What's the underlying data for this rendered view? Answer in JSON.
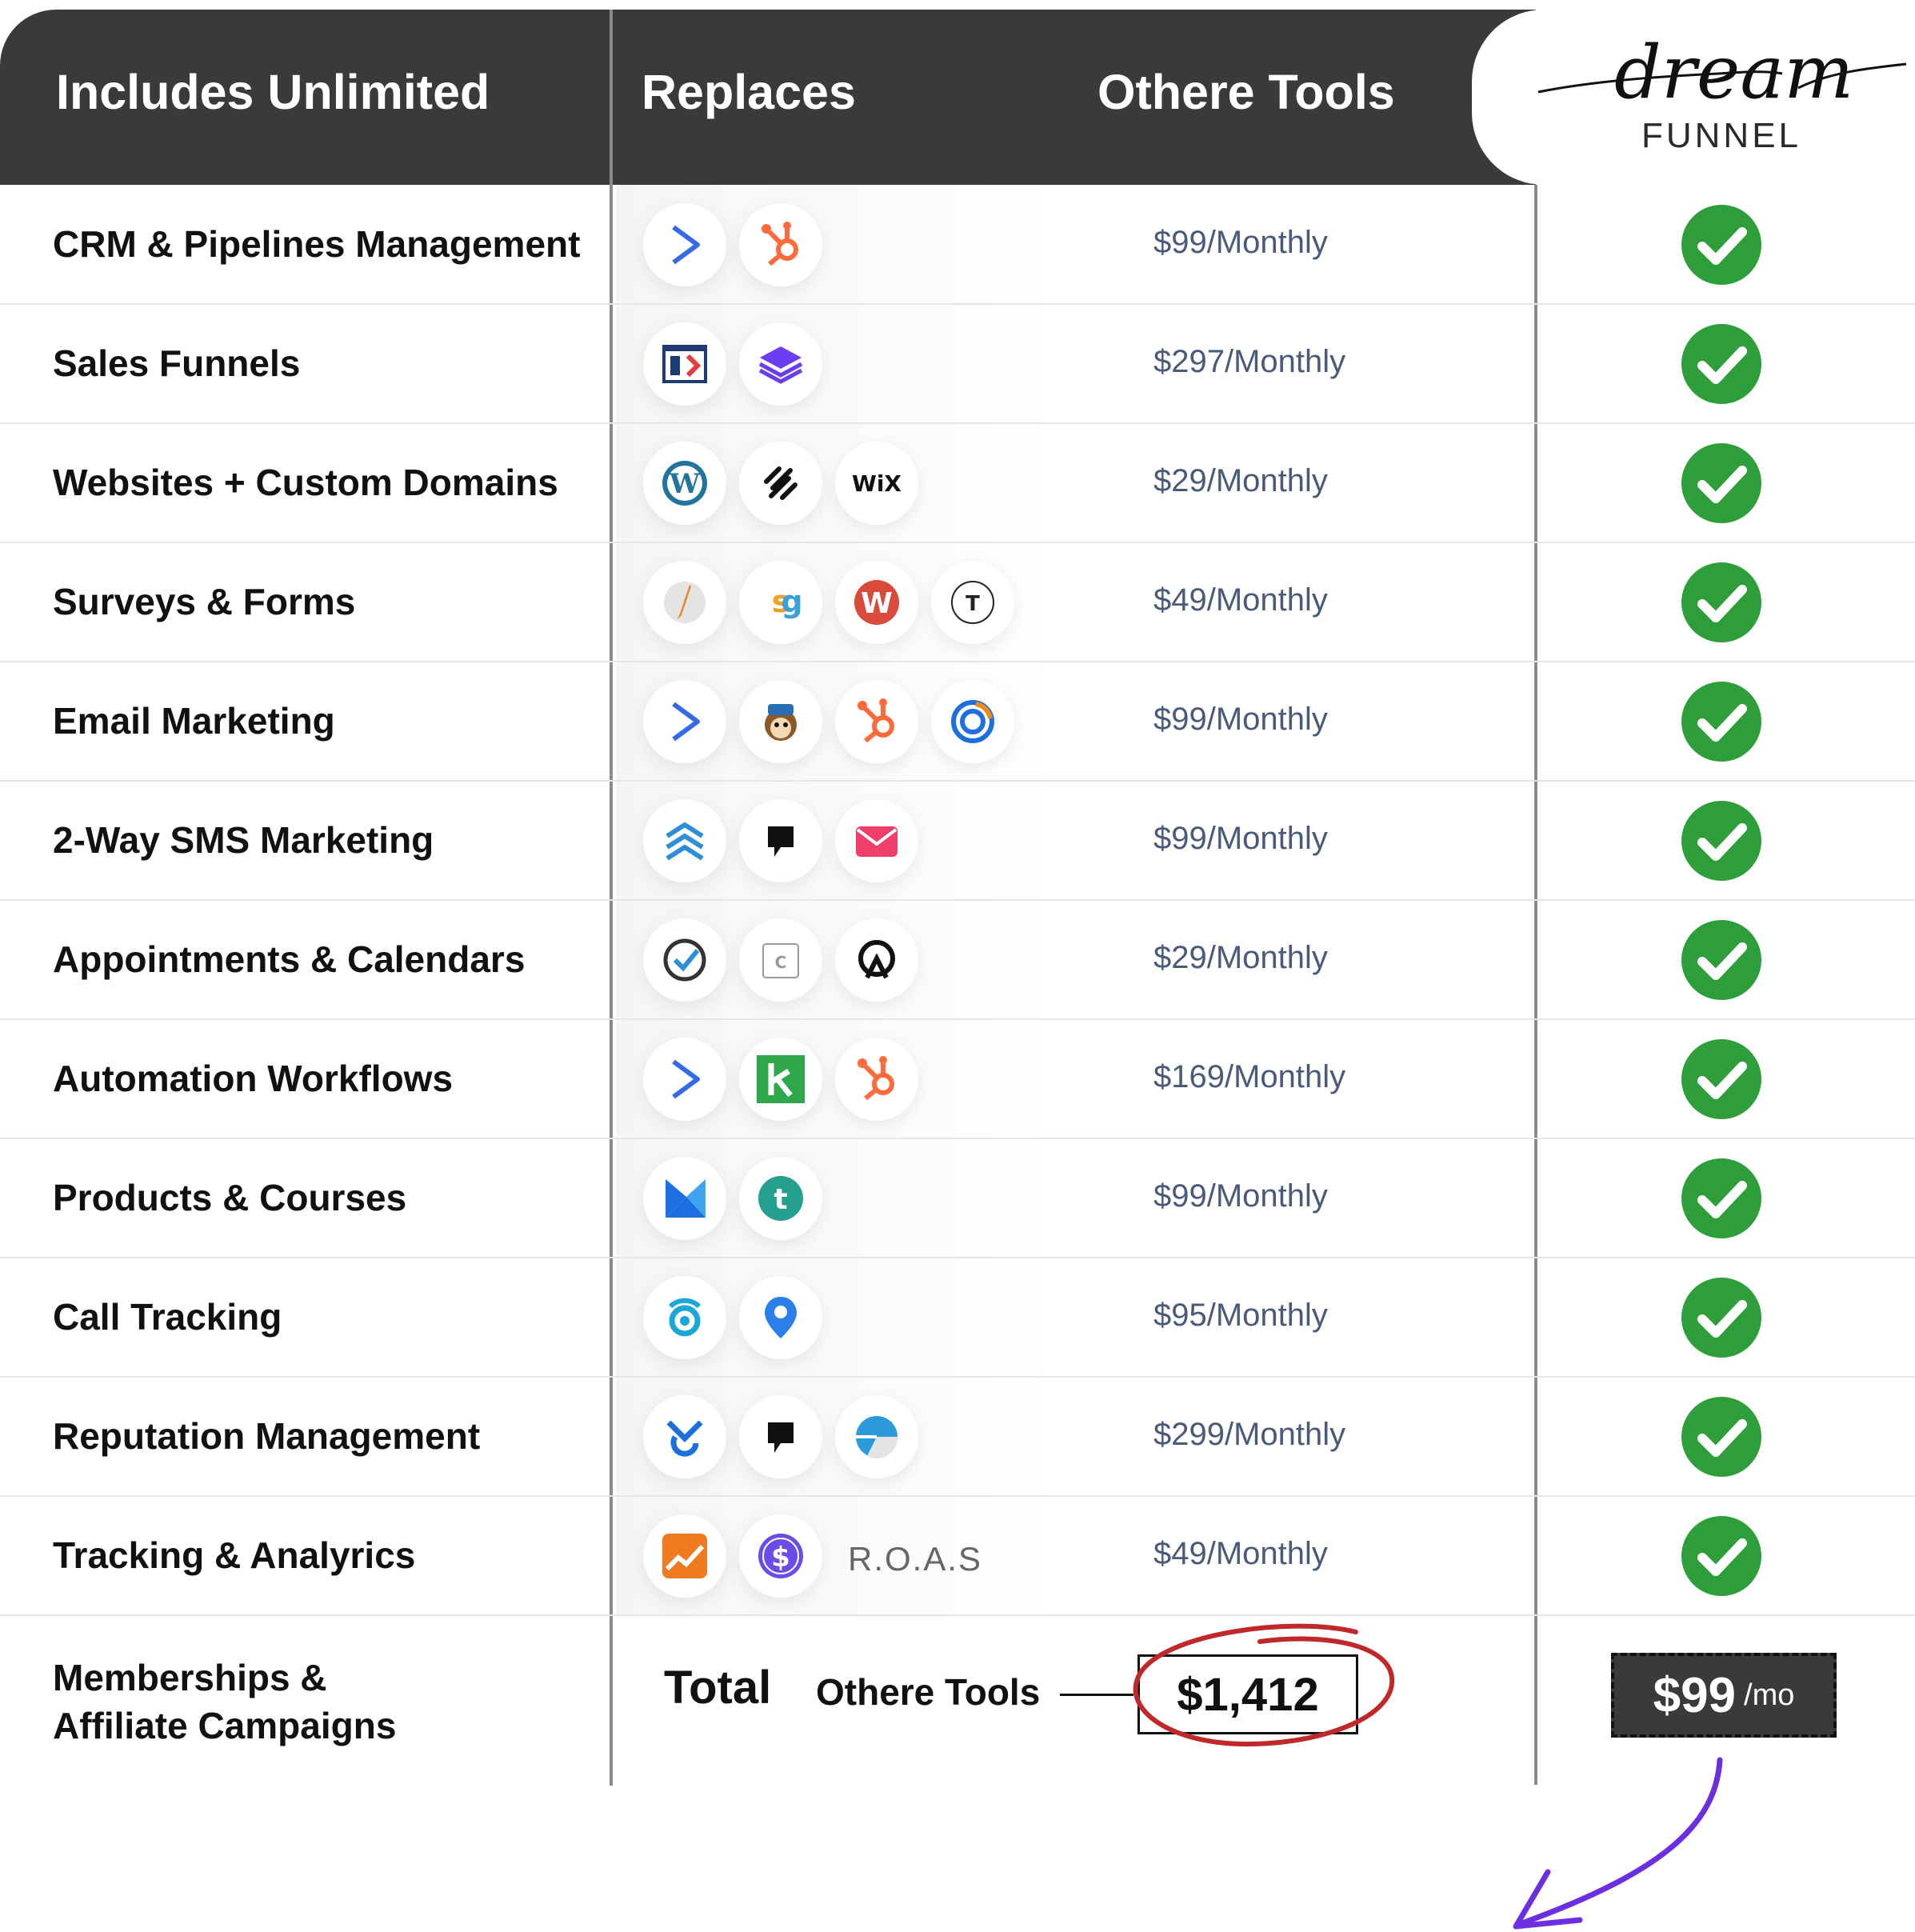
{
  "header": {
    "col1": "Includes Unlimited",
    "col2": "Replaces",
    "col3": "Othere Tools",
    "logo_script": "dream",
    "logo_word": "FUNNEL"
  },
  "rows": [
    {
      "feature": "CRM & Pipelines Management",
      "price": "$99/Monthly",
      "icons": [
        "activecampaign-icon",
        "hubspot-icon"
      ]
    },
    {
      "feature": "Sales Funnels",
      "price": "$297/Monthly",
      "icons": [
        "clickfunnels-icon",
        "layers-icon"
      ]
    },
    {
      "feature": "Websites + Custom Domains",
      "price": "$29/Monthly",
      "icons": [
        "wordpress-icon",
        "squarespace-icon",
        "wix-icon"
      ]
    },
    {
      "feature": "Surveys & Forms",
      "price": "$49/Monthly",
      "icons": [
        "pencil-icon",
        "surveygizmo-icon",
        "wufoo-icon",
        "typeform-icon"
      ]
    },
    {
      "feature": "Email Marketing",
      "price": "$99/Monthly",
      "icons": [
        "activecampaign-icon",
        "mailchimp-icon",
        "hubspot-icon",
        "constantcontact-icon"
      ]
    },
    {
      "feature": "2-Way SMS Marketing",
      "price": "$99/Monthly",
      "icons": [
        "chevrons-up-icon",
        "flag-icon",
        "envelope-icon"
      ]
    },
    {
      "feature": "Appointments & Calendars",
      "price": "$29/Monthly",
      "icons": [
        "check-circle-icon",
        "calendar-icon",
        "acuity-icon"
      ]
    },
    {
      "feature": "Automation Workflows",
      "price": "$169/Monthly",
      "icons": [
        "activecampaign-icon",
        "keap-icon",
        "hubspot-icon"
      ]
    },
    {
      "feature": "Products & Courses",
      "price": "$99/Monthly",
      "icons": [
        "kajabi-icon",
        "teachable-icon"
      ]
    },
    {
      "feature": "Call Tracking",
      "price": "$95/Monthly",
      "icons": [
        "callrail-icon",
        "phone-pin-icon"
      ]
    },
    {
      "feature": "Reputation Management",
      "price": "$299/Monthly",
      "icons": [
        "birdeye-icon",
        "flag-icon",
        "podium-icon"
      ]
    },
    {
      "feature": "Tracking & Analyrics",
      "price": "$49/Monthly",
      "icons": [
        "analytics-icon",
        "dollar-icon"
      ],
      "extra_text": "R.O.A.S"
    }
  ],
  "last_feature": {
    "line1": "Memberships &",
    "line2": "Affiliate Campaigns"
  },
  "total": {
    "label": "Total",
    "other_label": "Othere Tools",
    "amount": "$1,412",
    "dream_price": "$99",
    "dream_unit": "/mo"
  },
  "colors": {
    "header_bg": "#3a3a3a",
    "check_green": "#2e9e3a",
    "price_text": "#4a5a7a",
    "circle_red": "#c0282a",
    "arrow_purple": "#6a2fe0"
  }
}
